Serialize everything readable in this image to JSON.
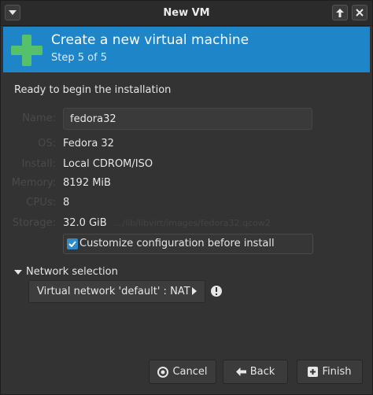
{
  "window": {
    "title": "New VM"
  },
  "banner": {
    "title": "Create a new virtual machine",
    "step": "Step 5 of 5"
  },
  "summary": {
    "heading": "Ready to begin the installation",
    "name_label": "Name:",
    "name_value": "fedora32",
    "os_label": "OS:",
    "os_value": "Fedora 32",
    "install_label": "Install:",
    "install_value": "Local CDROM/ISO",
    "memory_label": "Memory:",
    "memory_value": "8192 MiB",
    "cpus_label": "CPUs:",
    "cpus_value": "8",
    "storage_label": "Storage:",
    "storage_value": "32.0 GiB",
    "storage_path": ".../lib/libvirt/images/fedora32.qcow2"
  },
  "customize": {
    "label": "Customize configuration before install",
    "checked": true
  },
  "network": {
    "expander_label": "Network selection",
    "selected": "Virtual network 'default' : NAT"
  },
  "buttons": {
    "cancel": "Cancel",
    "back": "Back",
    "finish": "Finish"
  },
  "icons": {
    "menu": "chevron-down-icon",
    "maximize": "arrow-up-icon",
    "close": "close-icon",
    "banner": "plus-icon",
    "warning": "warning-icon",
    "cancel": "cancel-icon",
    "back": "arrow-left-icon",
    "finish": "finish-icon"
  },
  "colors": {
    "accent": "#1f85c9",
    "plus": "#55c16a",
    "background": "#333333"
  }
}
